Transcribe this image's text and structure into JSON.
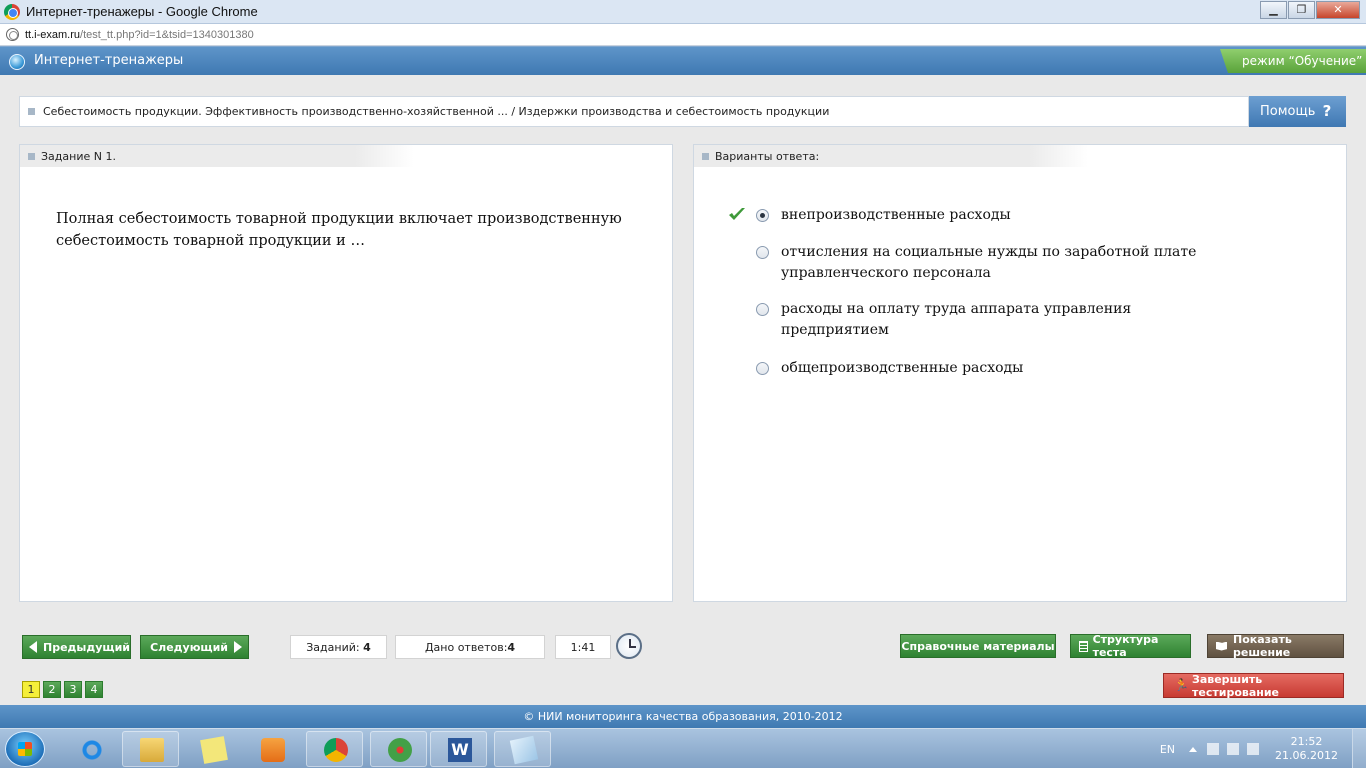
{
  "window": {
    "title": "Интернет-тренажеры - Google Chrome",
    "url_host": "tt.i-exam.ru",
    "url_path": "/test_tt.php?id=1&tsid=1340301380",
    "btn_minimize": "▁",
    "btn_restore": "❐",
    "btn_close": "✕"
  },
  "header": {
    "app_title": "Интернет-тренажеры",
    "mode": "режим “Обучение”"
  },
  "breadcrumb": {
    "text": "Себестоимость продукции. Эффективность производственно-хозяйственной ... / Издержки производства и себестоимость продукции",
    "help_label": "Помощь",
    "help_glyph": "?"
  },
  "task": {
    "heading": "Задание N 1.",
    "question": "Полная себестоимость товарной продукции включает производственную себестоимость товарной продукции и …"
  },
  "answers": {
    "heading": "Варианты ответа:",
    "options": [
      {
        "text": "внепроизводственные расходы",
        "selected": true,
        "correct": true
      },
      {
        "text": "отчисления на социальные нужды по заработной плате управленческого персонала",
        "selected": false
      },
      {
        "text": "расходы на оплату труда аппарата управления предприятием",
        "selected": false
      },
      {
        "text": "общепроизводственные расходы",
        "selected": false
      }
    ]
  },
  "toolbar": {
    "prev_label": "Предыдущий",
    "next_label": "Следующий",
    "tasks_label": "Заданий:",
    "tasks_count": "4",
    "answered_label": "Дано ответов:",
    "answered_count": "4",
    "timer": "1:41",
    "reference_label": "Справочные материалы",
    "structure_label": "Структура теста",
    "solution_label": "Показать решение",
    "finish_label": "Завершить тестирование",
    "finish_glyph": "🏃",
    "pages": [
      "1",
      "2",
      "3",
      "4"
    ],
    "current_page": "1"
  },
  "footer": {
    "copyright": "© НИИ мониторинга качества образования, 2010-2012"
  },
  "taskbar": {
    "lang": "EN",
    "word_glyph": "W",
    "time": "21:52",
    "date": "21.06.2012"
  },
  "colors": {
    "header_blue": "#3f79b2",
    "button_green": "#2e8231",
    "finish_red": "#c73a32",
    "current_page": "#f5ef3a",
    "mode_green": "#5aa33a"
  }
}
